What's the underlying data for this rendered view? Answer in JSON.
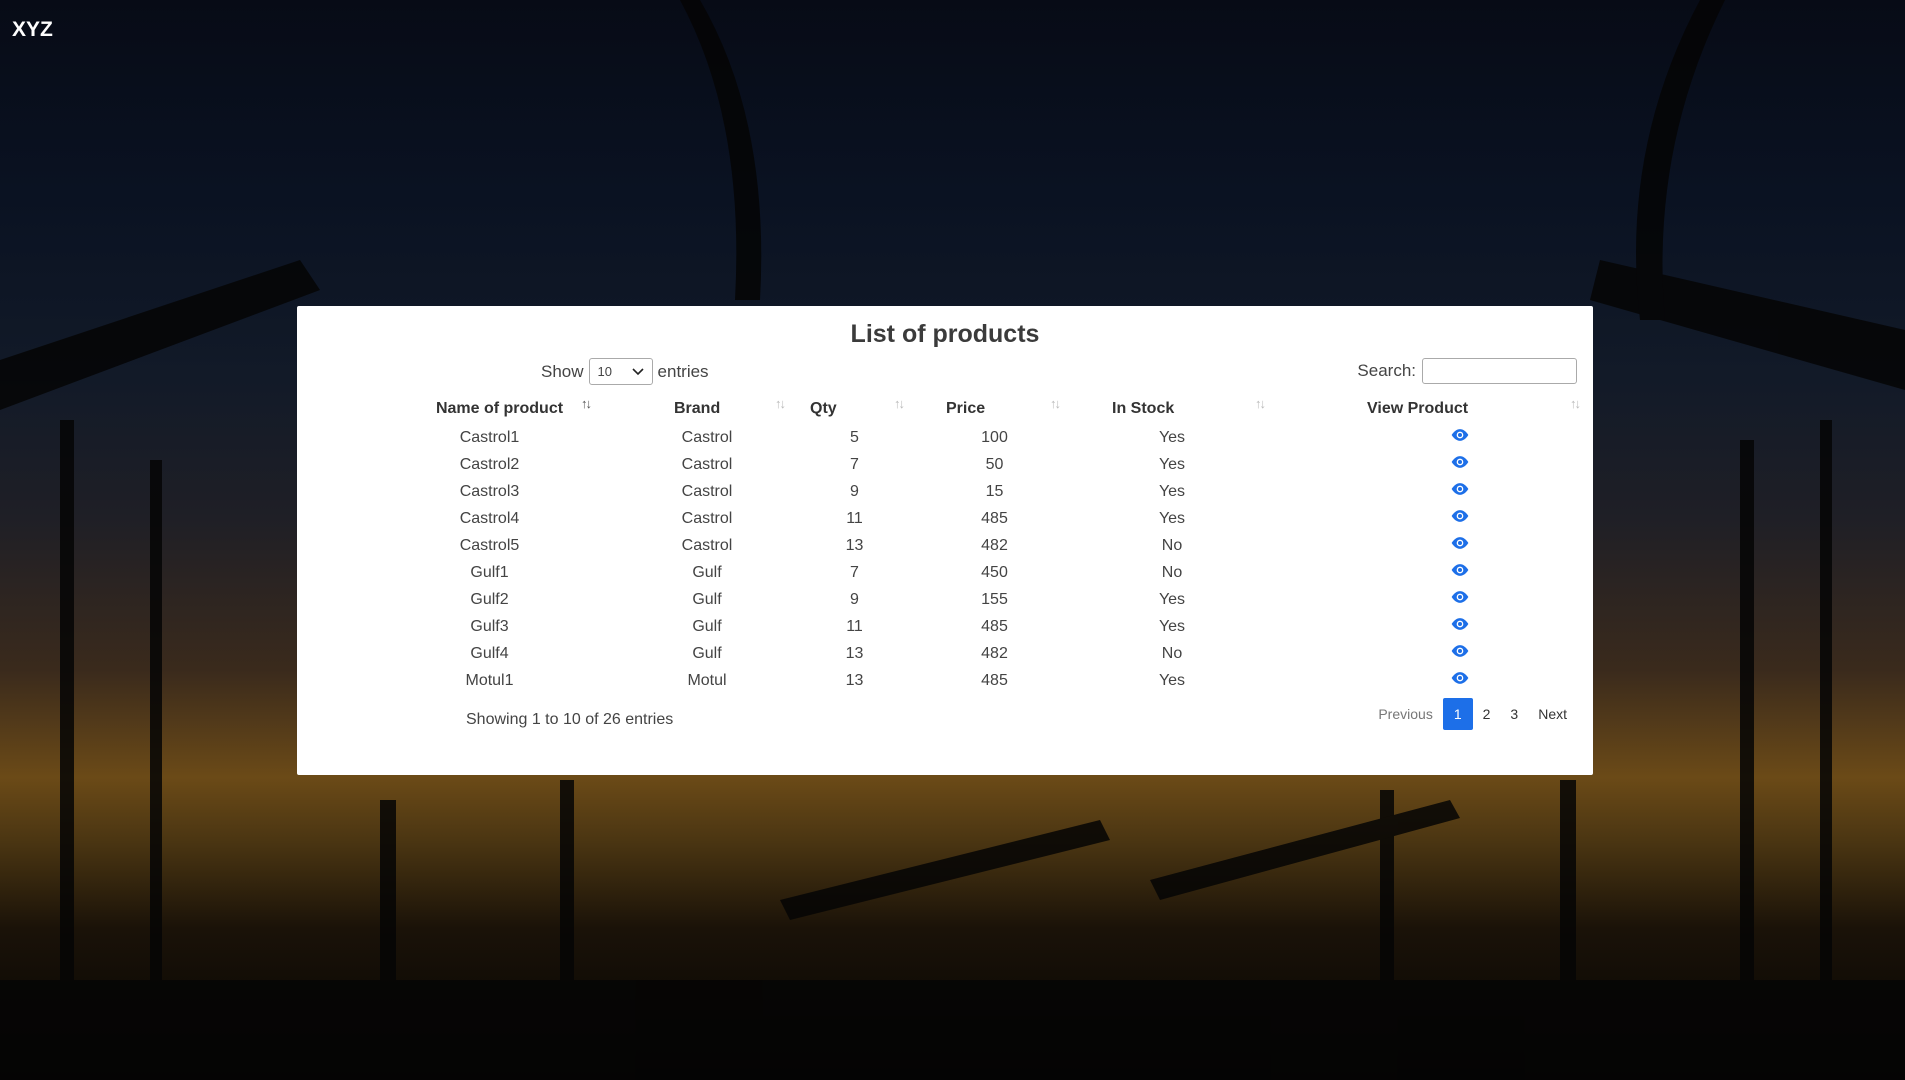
{
  "app": {
    "brand": "XYZ"
  },
  "panel": {
    "title": "List of products",
    "length": {
      "prefix": "Show",
      "value": "10",
      "suffix": "entries"
    },
    "search": {
      "label": "Search:",
      "value": "",
      "placeholder": ""
    }
  },
  "table": {
    "columns": [
      "Name of product",
      "Brand",
      "Qty",
      "Price",
      "In Stock",
      "View Product"
    ],
    "rows": [
      {
        "name": "Castrol1",
        "brand": "Castrol",
        "qty": "5",
        "price": "100",
        "stock": "Yes"
      },
      {
        "name": "Castrol2",
        "brand": "Castrol",
        "qty": "7",
        "price": "50",
        "stock": "Yes"
      },
      {
        "name": "Castrol3",
        "brand": "Castrol",
        "qty": "9",
        "price": "15",
        "stock": "Yes"
      },
      {
        "name": "Castrol4",
        "brand": "Castrol",
        "qty": "11",
        "price": "485",
        "stock": "Yes"
      },
      {
        "name": "Castrol5",
        "brand": "Castrol",
        "qty": "13",
        "price": "482",
        "stock": "No"
      },
      {
        "name": "Gulf1",
        "brand": "Gulf",
        "qty": "7",
        "price": "450",
        "stock": "No"
      },
      {
        "name": "Gulf2",
        "brand": "Gulf",
        "qty": "9",
        "price": "155",
        "stock": "Yes"
      },
      {
        "name": "Gulf3",
        "brand": "Gulf",
        "qty": "11",
        "price": "485",
        "stock": "Yes"
      },
      {
        "name": "Gulf4",
        "brand": "Gulf",
        "qty": "13",
        "price": "482",
        "stock": "No"
      },
      {
        "name": "Motul1",
        "brand": "Motul",
        "qty": "13",
        "price": "485",
        "stock": "Yes"
      }
    ],
    "view_icon": "eye-icon",
    "sort_icon": "sort-arrows-icon"
  },
  "footer": {
    "info": "Showing 1 to 10 of 26 entries",
    "pagination": {
      "previous": "Previous",
      "pages": [
        "1",
        "2",
        "3"
      ],
      "active": "1",
      "next": "Next"
    }
  },
  "colors": {
    "accent": "#1d6fe8",
    "panel_bg": "#ffffff"
  }
}
